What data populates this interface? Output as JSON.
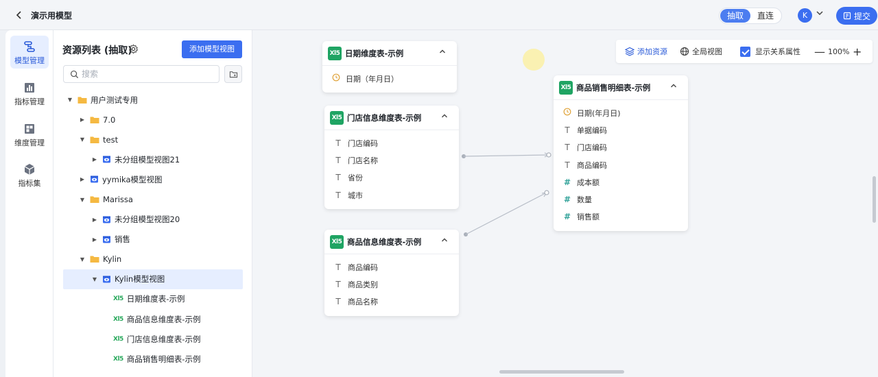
{
  "header": {
    "title": "演示用模型",
    "modes": [
      "抽取",
      "直连"
    ],
    "active_mode": "抽取",
    "user_initial": "K",
    "submit_label": "提交"
  },
  "leftnav": {
    "items": [
      {
        "label": "模型管理",
        "icon": "model-icon",
        "active": true
      },
      {
        "label": "指标管理",
        "icon": "metric-icon",
        "active": false
      },
      {
        "label": "维度管理",
        "icon": "dimension-icon",
        "active": false
      },
      {
        "label": "指标集",
        "icon": "cube-icon",
        "active": false
      }
    ]
  },
  "resources": {
    "title": "资源列表 (抽取)",
    "add_view_label": "添加模型视图",
    "search_placeholder": "搜索",
    "tree": [
      {
        "label": "用户测试专用",
        "type": "folder",
        "level": 0,
        "expanded": true
      },
      {
        "label": "7.0",
        "type": "folder",
        "level": 1,
        "expanded": false
      },
      {
        "label": "test",
        "type": "folder",
        "level": 1,
        "expanded": true
      },
      {
        "label": "未分组模型视图21",
        "type": "view",
        "level": 2,
        "expanded": false
      },
      {
        "label": "yymika模型视图",
        "type": "view",
        "level": 1,
        "expanded": false
      },
      {
        "label": "Marissa",
        "type": "folder",
        "level": 1,
        "expanded": true
      },
      {
        "label": "未分组模型视图20",
        "type": "view",
        "level": 2,
        "expanded": false
      },
      {
        "label": "销售",
        "type": "view",
        "level": 2,
        "expanded": false
      },
      {
        "label": "Kylin",
        "type": "folder",
        "level": 1,
        "expanded": true
      },
      {
        "label": "Kylin模型视图",
        "type": "view",
        "level": 2,
        "expanded": true,
        "selected": true
      },
      {
        "label": "日期维度表-示例",
        "type": "table",
        "level": 3
      },
      {
        "label": "商品信息维度表-示例",
        "type": "table",
        "level": 3
      },
      {
        "label": "门店信息维度表-示例",
        "type": "table",
        "level": 3
      },
      {
        "label": "商品销售明细表-示例",
        "type": "table",
        "level": 3
      }
    ]
  },
  "toolbar": {
    "add_resource": "添加资源",
    "global_view": "全局视图",
    "show_relation": "显示关系属性",
    "show_relation_checked": true,
    "zoom": "100%"
  },
  "canvas": {
    "tables": [
      {
        "id": "date",
        "title": "日期维度表-示例",
        "fields": [
          {
            "name": "日期（年月日）",
            "type": "date"
          }
        ]
      },
      {
        "id": "store",
        "title": "门店信息维度表-示例",
        "fields": [
          {
            "name": "门店编码",
            "type": "text"
          },
          {
            "name": "门店名称",
            "type": "text"
          },
          {
            "name": "省份",
            "type": "text"
          },
          {
            "name": "城市",
            "type": "text"
          }
        ]
      },
      {
        "id": "product",
        "title": "商品信息维度表-示例",
        "fields": [
          {
            "name": "商品编码",
            "type": "text"
          },
          {
            "name": "商品类别",
            "type": "text"
          },
          {
            "name": "商品名称",
            "type": "text"
          }
        ]
      },
      {
        "id": "sales",
        "title": "商品销售明细表-示例",
        "fields": [
          {
            "name": "日期(年月日)",
            "type": "date"
          },
          {
            "name": "单据编码",
            "type": "text"
          },
          {
            "name": "门店编码",
            "type": "text"
          },
          {
            "name": "商品编码",
            "type": "text"
          },
          {
            "name": "成本额",
            "type": "number"
          },
          {
            "name": "数量",
            "type": "number"
          },
          {
            "name": "销售额",
            "type": "number"
          }
        ]
      }
    ],
    "xls_badge": "Xl5"
  }
}
